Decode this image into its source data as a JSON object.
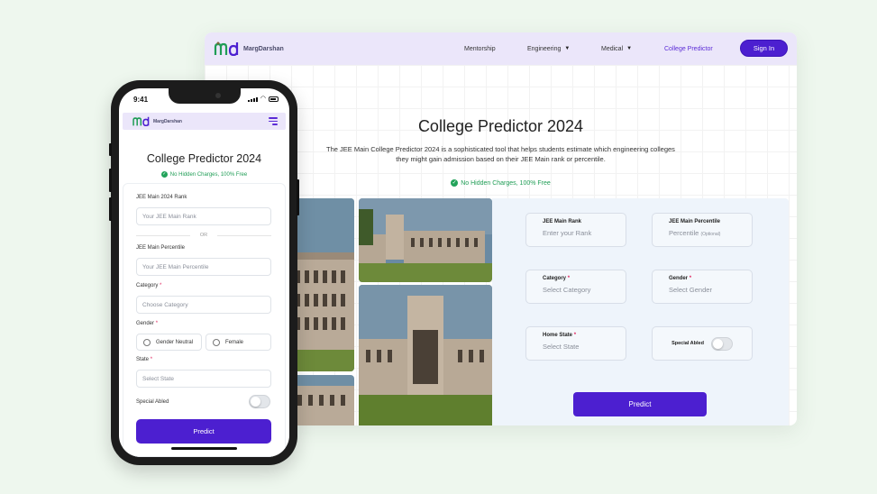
{
  "desktop": {
    "logo_text": "MargDarshan",
    "nav": {
      "mentorship": "Mentorship",
      "engineering": "Engineering",
      "medical": "Medical",
      "college_predictor": "College Predictor",
      "sign_in": "Sign In"
    },
    "title": "College Predictor 2024",
    "description": "The JEE Main College Predictor 2024 is a sophisticated tool that helps students estimate which engineering colleges they might gain admission based on their JEE Main rank or percentile.",
    "free_note": "No Hidden Charges, 100% Free",
    "form": {
      "rank_label": "JEE Main Rank",
      "rank_placeholder": "Enter your Rank",
      "percentile_label": "JEE Main Percentile",
      "percentile_placeholder": "Percentile",
      "percentile_optional": "(Optional)",
      "category_label": "Category",
      "category_placeholder": "Select Category",
      "gender_label": "Gender",
      "gender_placeholder": "Select Gender",
      "home_state_label": "Home State",
      "home_state_placeholder": "Select State",
      "special_abled_label": "Special Abled",
      "required_mark": "*",
      "predict": "Predict"
    }
  },
  "phone": {
    "time": "9:41",
    "logo_text": "MargDarshan",
    "title": "College Predictor 2024",
    "free_note": "No Hidden Charges, 100% Free",
    "form": {
      "rank_label": "JEE Main 2024 Rank",
      "rank_placeholder": "Your JEE Main Rank",
      "or": "OR",
      "percentile_label": "JEE Main Percentile",
      "percentile_placeholder": "Your JEE Main Percentile",
      "category_label": "Category",
      "category_placeholder": "Choose Category",
      "gender_label": "Gender",
      "gender_options": [
        "Gender Neutral",
        "Female"
      ],
      "state_label": "State",
      "state_placeholder": "Select State",
      "special_abled_label": "Special Abled",
      "required_mark": "*",
      "predict": "Predict"
    }
  },
  "colors": {
    "accent": "#4c1fd0",
    "nav_bg": "#ebe6fa",
    "success": "#1f9d55",
    "page_bg": "#eef7ee"
  }
}
